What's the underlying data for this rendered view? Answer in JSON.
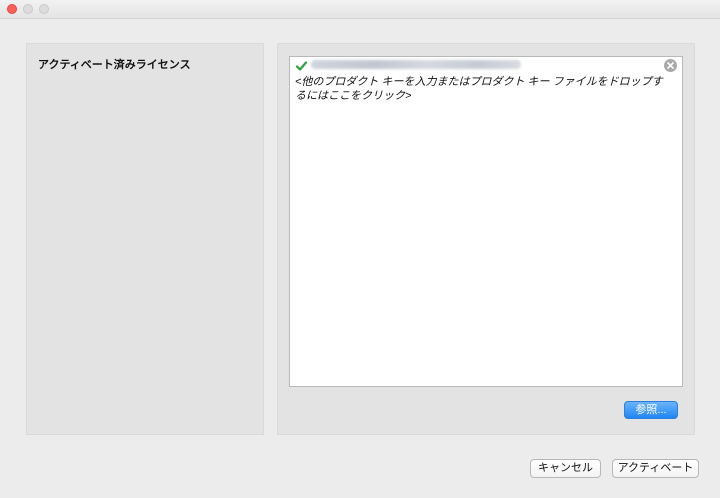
{
  "window": {
    "buttons": [
      "close",
      "minimize",
      "zoom"
    ]
  },
  "left_panel": {
    "heading": "アクティベート済みライセンス"
  },
  "license_list": {
    "status_icon": "check-icon",
    "status_color": "#2aa33a",
    "prompt": "<他のプロダクト キーを入力またはプロダクト キー ファイルをドロップするにはここをクリック>",
    "remove_icon": "close-circle-icon"
  },
  "browse_button": {
    "label": "参照...",
    "color": "#1f86f2"
  },
  "footer": {
    "cancel_label": "キャンセル",
    "activate_label": "アクティベート"
  }
}
